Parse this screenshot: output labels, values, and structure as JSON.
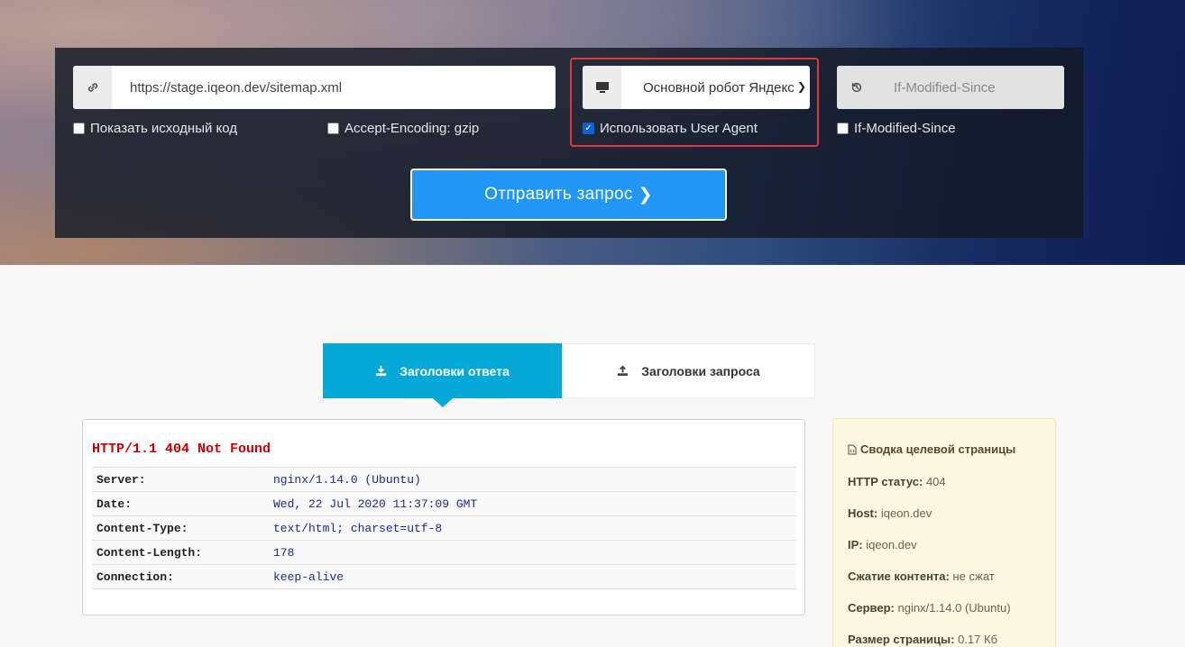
{
  "form": {
    "url_value": "https://stage.iqeon.dev/sitemap.xml",
    "user_agent_selected": "Основной робот Яндекса",
    "if_modified_since_placeholder": "If-Modified-Since",
    "checkboxes": {
      "show_source": {
        "label": "Показать исходный код",
        "checked": false
      },
      "accept_encoding": {
        "label": "Accept-Encoding: gzip",
        "checked": false
      },
      "use_user_agent": {
        "label": "Использовать User Agent",
        "checked": true
      },
      "if_modified_since": {
        "label": "If-Modified-Since",
        "checked": false
      }
    },
    "submit_label": "Отправить запрос",
    "highlight_color": "#e0373a",
    "button_color": "#2196f3"
  },
  "tabs": [
    {
      "label": "Заголовки ответа",
      "active": true
    },
    {
      "label": "Заголовки запроса",
      "active": false
    }
  ],
  "response": {
    "status_line": "HTTP/1.1 404 Not Found",
    "headers": [
      {
        "key": "Server:",
        "value": "nginx/1.14.0 (Ubuntu)"
      },
      {
        "key": "Date:",
        "value": "Wed, 22 Jul 2020 11:37:09 GMT"
      },
      {
        "key": "Content-Type:",
        "value": "text/html; charset=utf-8"
      },
      {
        "key": "Content-Length:",
        "value": "178"
      },
      {
        "key": "Connection:",
        "value": "keep-alive"
      }
    ]
  },
  "summary": {
    "title": "Сводка целевой страницы",
    "rows": [
      {
        "label": "HTTP статус:",
        "value": "404"
      },
      {
        "label": "Host:",
        "value": "iqeon.dev"
      },
      {
        "label": "IP:",
        "value": "iqeon.dev"
      },
      {
        "label": "Сжатие контента:",
        "value": "не сжат"
      },
      {
        "label": "Сервер:",
        "value": "nginx/1.14.0 (Ubuntu)"
      },
      {
        "label": "Размер страницы:",
        "value": "0.17 Кб"
      }
    ]
  },
  "icons": {
    "url": "link-icon",
    "user_agent": "monitor-icon",
    "if_modified": "history-icon",
    "tab_response": "download-icon",
    "tab_request": "upload-icon",
    "summary": "file-code-icon"
  }
}
